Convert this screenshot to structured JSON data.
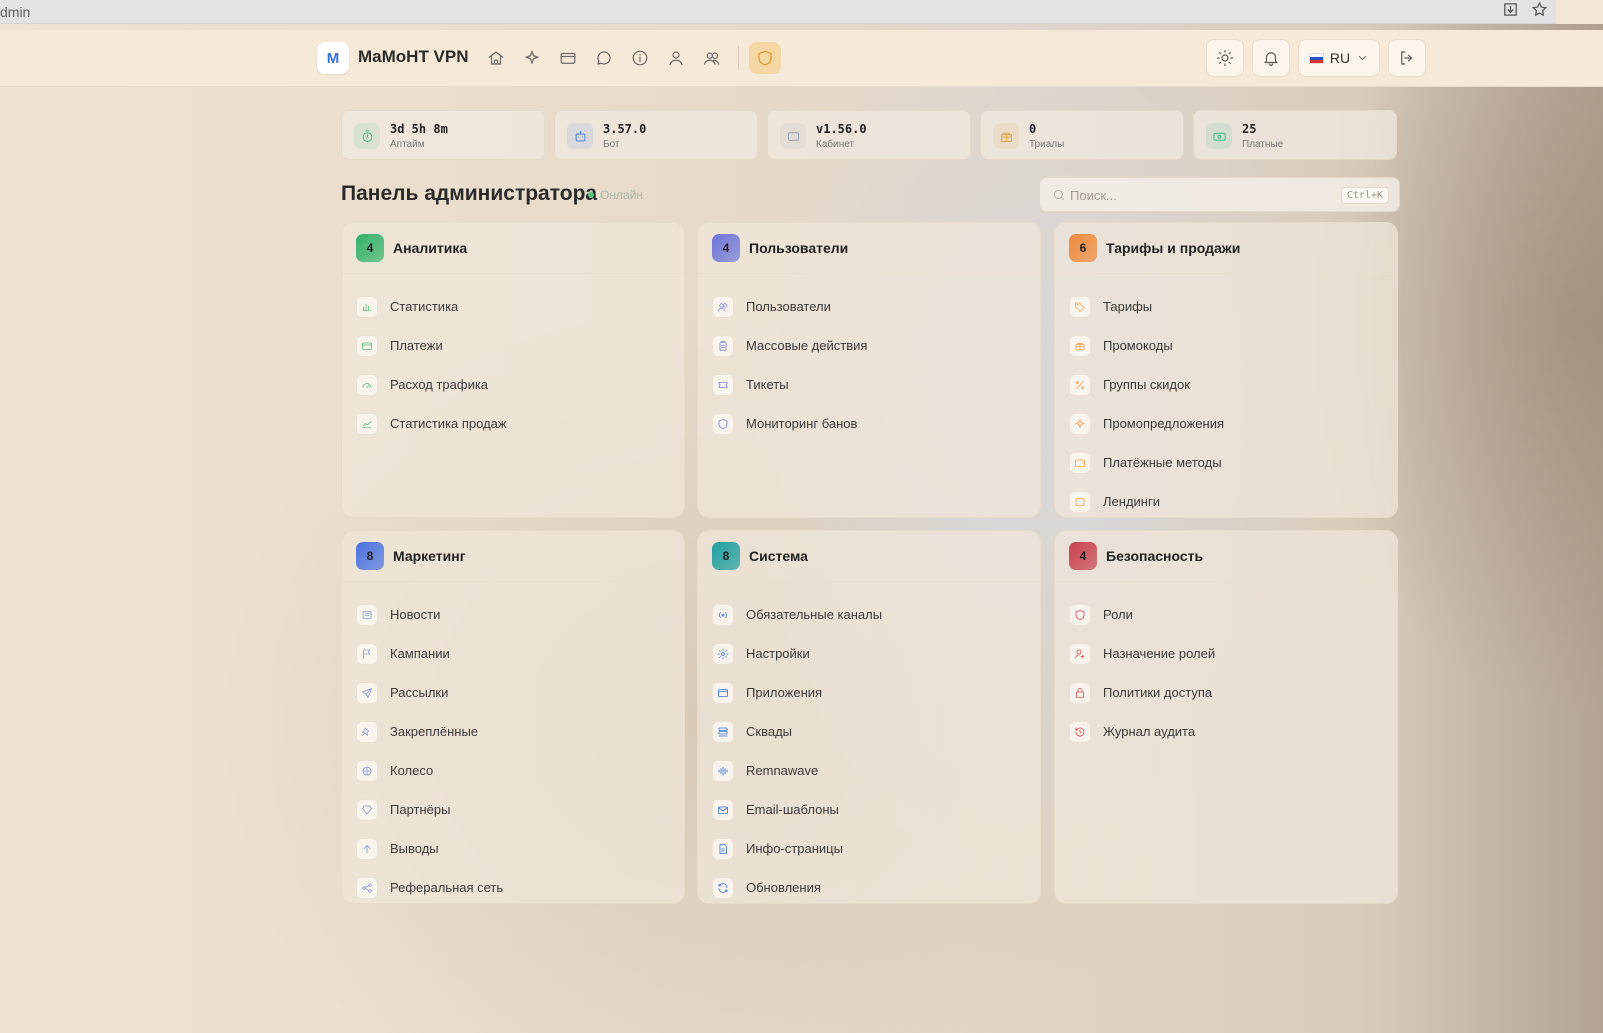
{
  "browser": {
    "url": "dmin"
  },
  "header": {
    "logo_letter": "M",
    "app_title": "MaMoHT VPN",
    "lang": "RU",
    "nav": [
      "home-icon",
      "sparkle-icon",
      "card-icon",
      "chat-icon",
      "info-icon",
      "user-icon",
      "users-icon",
      "shield-icon"
    ]
  },
  "stats": [
    {
      "value": "3d 5h 8m",
      "label": "Аптайм",
      "color": "#4ec27a"
    },
    {
      "value": "3.57.0",
      "label": "Бот",
      "color": "#4a7ee0"
    },
    {
      "value": "v1.56.0",
      "label": "Кабинет",
      "color": "#9aa3b5"
    },
    {
      "value": "0",
      "label": "Триалы",
      "color": "#e6a547"
    },
    {
      "value": "25",
      "label": "Платные",
      "color": "#3fbf86"
    }
  ],
  "page": {
    "title": "Панель администратора",
    "status": "Онлайн",
    "search_placeholder": "Поиск...",
    "search_shortcut": "Ctrl+K"
  },
  "sections": [
    {
      "title": "Аналитика",
      "count": "4",
      "accent": "#33b36b",
      "items": [
        "Статистика",
        "Платежи",
        "Расход трафика",
        "Статистика продаж"
      ]
    },
    {
      "title": "Пользователи",
      "count": "4",
      "accent": "#6f76d9",
      "items": [
        "Пользователи",
        "Массовые действия",
        "Тикеты",
        "Мониторинг банов"
      ]
    },
    {
      "title": "Тарифы и продажи",
      "count": "6",
      "accent": "#f08a3c",
      "items": [
        "Тарифы",
        "Промокоды",
        "Группы скидок",
        "Промопредложения",
        "Платёжные методы",
        "Лендинги"
      ]
    },
    {
      "title": "Маркетинг",
      "count": "8",
      "accent": "#4a72e0",
      "items": [
        "Новости",
        "Кампании",
        "Рассылки",
        "Закреплённые",
        "Колесо",
        "Партнёры",
        "Выводы",
        "Реферальная сеть"
      ]
    },
    {
      "title": "Система",
      "count": "8",
      "accent": "#1f9fa0",
      "items": [
        "Обязательные каналы",
        "Настройки",
        "Приложения",
        "Сквады",
        "Remnawave",
        "Email-шаблоны",
        "Инфо-страницы",
        "Обновления"
      ]
    },
    {
      "title": "Безопасность",
      "count": "4",
      "accent": "#c8414e",
      "items": [
        "Роли",
        "Назначение ролей",
        "Политики доступа",
        "Журнал аудита"
      ]
    }
  ]
}
